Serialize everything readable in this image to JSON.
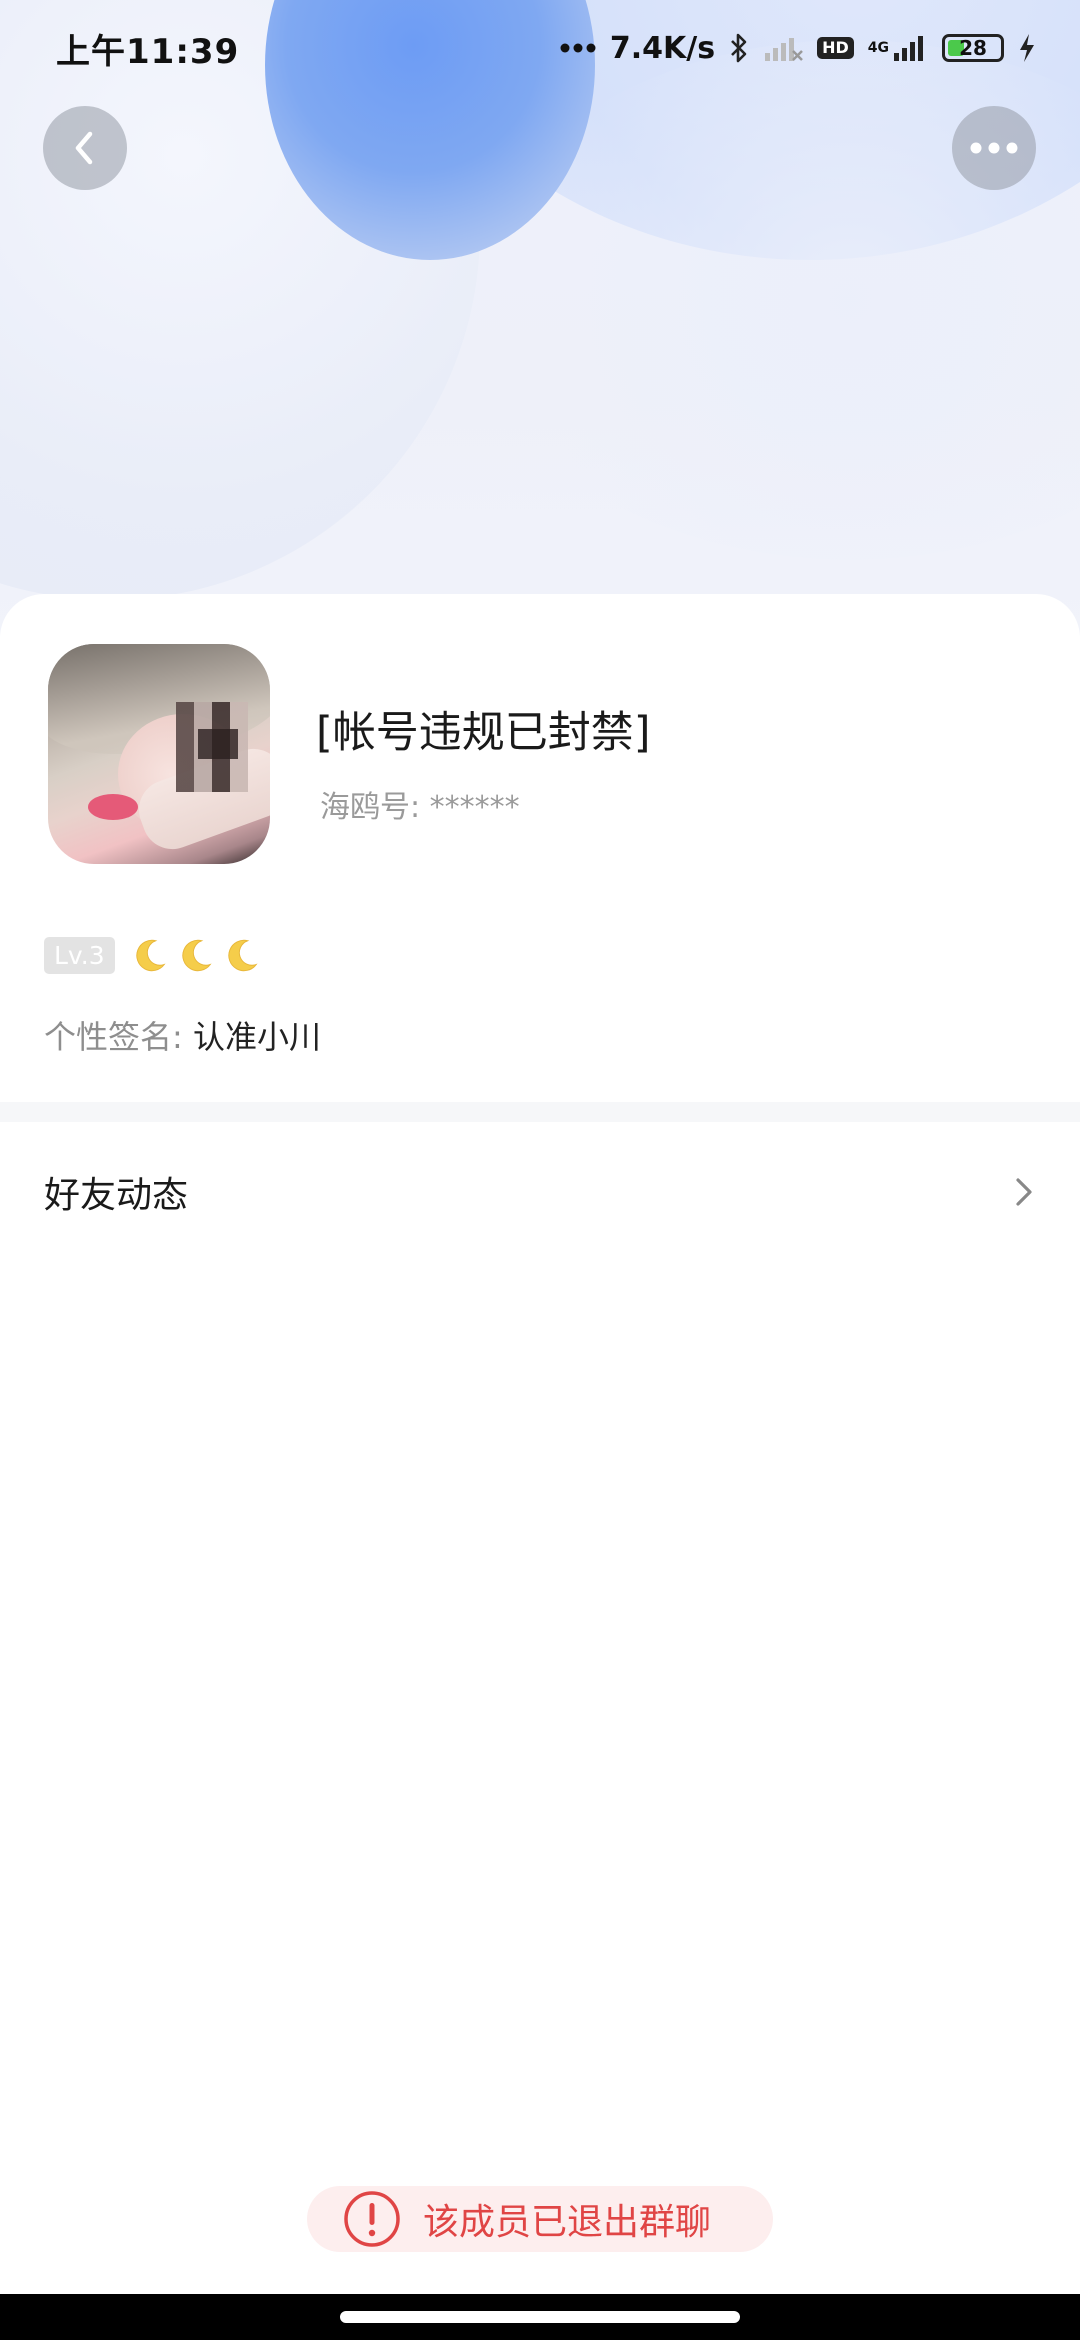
{
  "status_bar": {
    "time": "上午11:39",
    "network_speed": "7.4K/s",
    "hd_label": "HD",
    "network_type": "4G",
    "battery_level": "28"
  },
  "nav": {
    "back_icon": "chevron-left-icon",
    "more_icon": "more-horizontal-icon"
  },
  "profile": {
    "name": "[帐号违规已封禁]",
    "account_label": "海鸥号:",
    "account_value": "******",
    "level": "Lv.3",
    "level_icons": [
      "moon-icon",
      "moon-icon",
      "moon-icon"
    ],
    "signature_label": "个性签名:",
    "signature_value": "认准小川"
  },
  "friend_feed": {
    "label": "好友动态"
  },
  "toast": {
    "message": "该成员已退出群聊",
    "icon": "exclamation-circle-icon"
  },
  "colors": {
    "toast_text": "#e04545",
    "toast_bg": "#fdeeee",
    "battery_fill": "#4bc94b",
    "moon": "#f5cd4a"
  }
}
